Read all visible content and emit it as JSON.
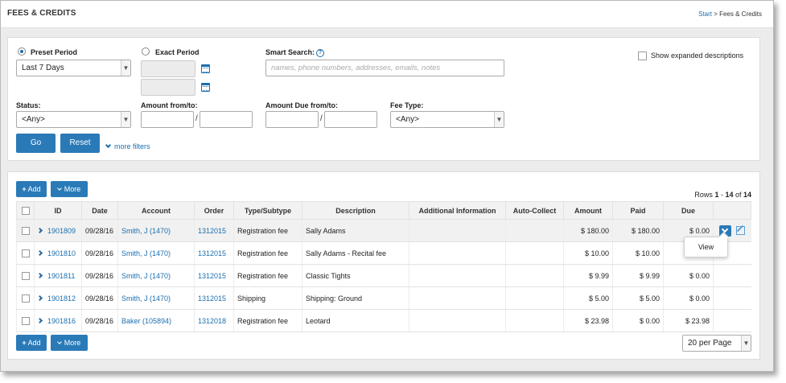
{
  "page": {
    "title": "FEES & CREDITS"
  },
  "breadcrumb": {
    "start": "Start",
    "separator": " > ",
    "current": "Fees & Credits"
  },
  "filters": {
    "preset_period_label": "Preset Period",
    "preset_period_value": "Last 7 Days",
    "exact_period_label": "Exact Period",
    "smart_search_label": "Smart Search:",
    "smart_search_placeholder": "names, phone numbers, addresses, emails, notes",
    "show_expanded_label": "Show expanded descriptions",
    "status_label": "Status:",
    "status_value": "<Any>",
    "amount_label": "Amount from/to:",
    "amount_due_label": "Amount Due from/to:",
    "fee_type_label": "Fee Type:",
    "fee_type_value": "<Any>",
    "slash": "/",
    "go_label": "Go",
    "reset_label": "Reset",
    "more_filters_label": "more filters"
  },
  "toolbar": {
    "add_label": "Add",
    "more_label": "More"
  },
  "rows_info": {
    "prefix": "Rows ",
    "start": "1",
    "dash": " - ",
    "end": "14",
    "of": " of ",
    "total": "14"
  },
  "table": {
    "headers": [
      "ID",
      "Date",
      "Account",
      "Order",
      "Type/Subtype",
      "Description",
      "Additional Information",
      "Auto-Collect",
      "Amount",
      "Paid",
      "Due"
    ],
    "rows": [
      {
        "id": "1901809",
        "date": "09/28/16",
        "account": "Smith, J (1470)",
        "order": "1312015",
        "type": "Registration fee",
        "description": "Sally Adams",
        "additional": "",
        "auto": "",
        "amount": "$ 180.00",
        "paid": "$ 180.00",
        "due": "$ 0.00"
      },
      {
        "id": "1901810",
        "date": "09/28/16",
        "account": "Smith, J (1470)",
        "order": "1312015",
        "type": "Registration fee",
        "description": "Sally Adams - Recital fee",
        "additional": "",
        "auto": "",
        "amount": "$ 10.00",
        "paid": "$ 10.00",
        "due": ""
      },
      {
        "id": "1901811",
        "date": "09/28/16",
        "account": "Smith, J (1470)",
        "order": "1312015",
        "type": "Registration fee",
        "description": "Classic Tights",
        "additional": "",
        "auto": "",
        "amount": "$ 9.99",
        "paid": "$ 9.99",
        "due": "$ 0.00"
      },
      {
        "id": "1901812",
        "date": "09/28/16",
        "account": "Smith, J (1470)",
        "order": "1312015",
        "type": "Shipping",
        "description": "Shipping: Ground",
        "additional": "",
        "auto": "",
        "amount": "$ 5.00",
        "paid": "$ 5.00",
        "due": "$ 0.00"
      },
      {
        "id": "1901816",
        "date": "09/28/16",
        "account": "Baker (105894)",
        "order": "1312018",
        "type": "Registration fee",
        "description": "Leotard",
        "additional": "",
        "auto": "",
        "amount": "$ 23.98",
        "paid": "$ 0.00",
        "due": "$ 23.98"
      }
    ]
  },
  "row_menu": {
    "view_label": "View"
  },
  "pagination": {
    "per_page_value": "20 per Page"
  },
  "colors": {
    "accent": "#2a7ab8",
    "link": "#1a6fb0"
  }
}
